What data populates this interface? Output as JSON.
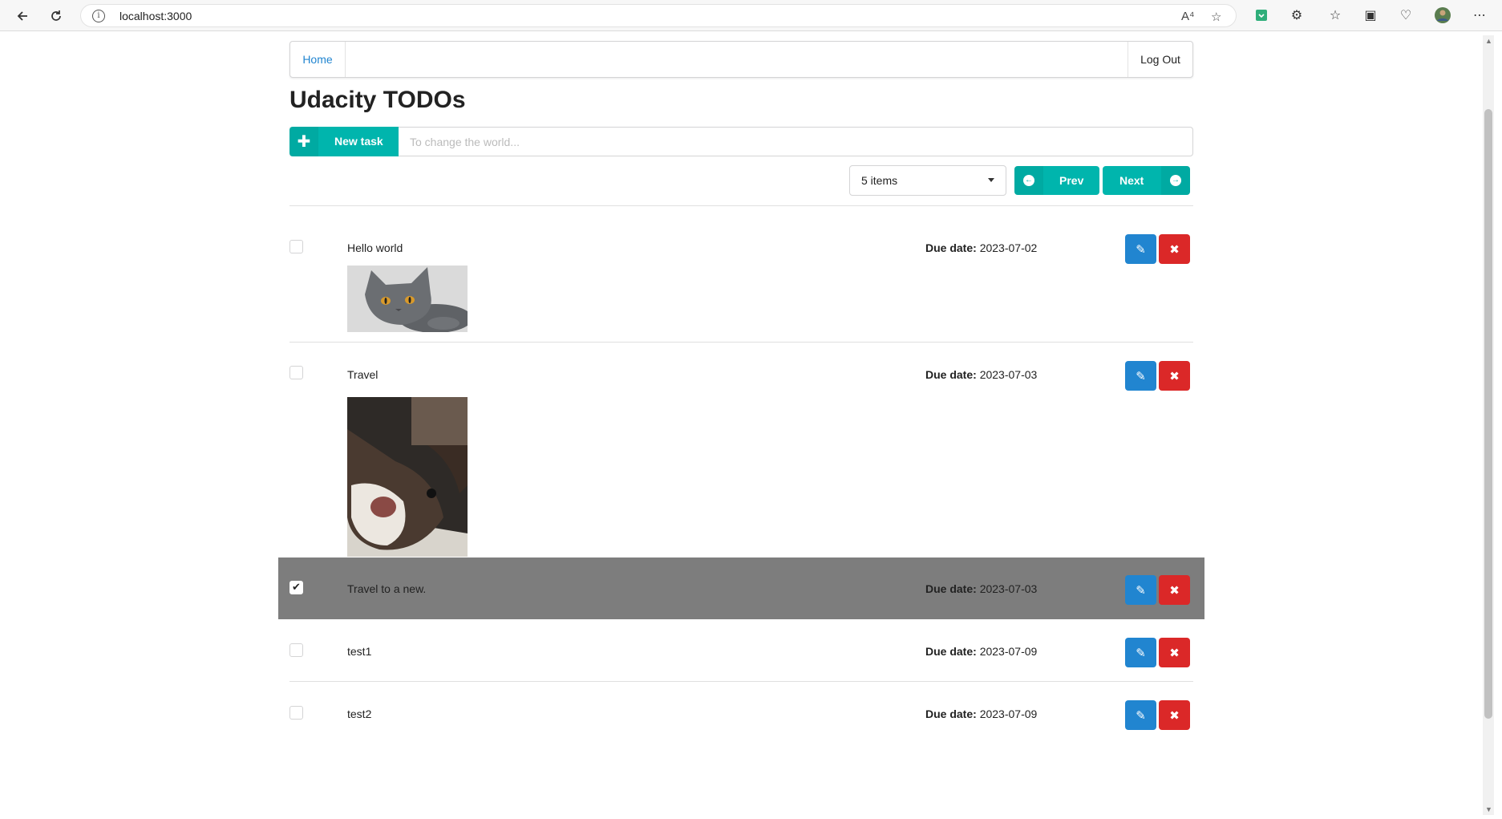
{
  "browser": {
    "url": "localhost:3000",
    "read_aloud_label": "A⁴"
  },
  "menu": {
    "home": "Home",
    "logout": "Log Out"
  },
  "page_title": "Udacity TODOs",
  "new_task": {
    "button_label": "New task",
    "placeholder": "To change the world..."
  },
  "pager": {
    "items_per_page": "5 items",
    "prev_label": "Prev",
    "next_label": "Next"
  },
  "todos": [
    {
      "name": "Hello world",
      "due_label": "Due date:",
      "due_date": "2023-07-02",
      "done": false,
      "image": "cat-photo"
    },
    {
      "name": "Travel",
      "due_label": "Due date:",
      "due_date": "2023-07-03",
      "done": false,
      "image": "dog-photo"
    },
    {
      "name": "Travel to a new.",
      "due_label": "Due date:",
      "due_date": "2023-07-03",
      "done": true
    },
    {
      "name": "test1",
      "due_label": "Due date:",
      "due_date": "2023-07-09",
      "done": false
    },
    {
      "name": "test2",
      "due_label": "Due date:",
      "due_date": "2023-07-09",
      "done": false
    }
  ],
  "colors": {
    "teal": "#00b5ad",
    "blue": "#2185d0",
    "red": "#db2828",
    "done_row": "#7d7d7d"
  }
}
